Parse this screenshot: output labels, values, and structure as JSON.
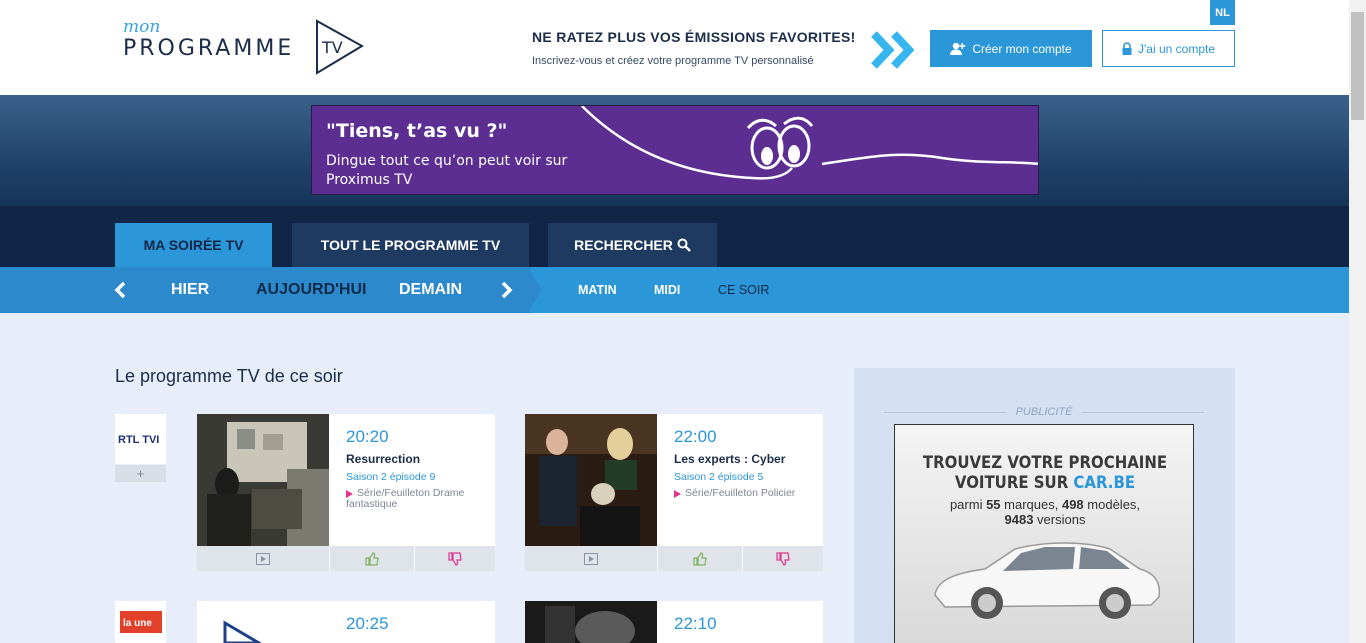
{
  "header": {
    "logo_mon": "mon",
    "logo_programme": "PROGRAMME",
    "logo_tv": "TV",
    "promo_title": "NE RATEZ PLUS VOS ÉMISSIONS FAVORITES!",
    "promo_subtitle": "Inscrivez-vous et créez votre programme TV personnalisé",
    "create_account": "Créer mon compte",
    "login": "J'ai un compte",
    "lang": "NL"
  },
  "banner": {
    "title": "\"Tiens, t’as vu ?\"",
    "text": "Dingue tout ce qu’on peut voir sur Proximus TV"
  },
  "tabs": [
    {
      "label": "MA SOIRÉE TV",
      "active": true
    },
    {
      "label": "TOUT LE PROGRAMME TV",
      "active": false
    },
    {
      "label": "RECHERCHER",
      "active": false
    }
  ],
  "days": [
    {
      "label": "HIER",
      "active": false
    },
    {
      "label": "AUJOURD'HUI",
      "active": true
    },
    {
      "label": "DEMAIN",
      "active": false
    }
  ],
  "slots": [
    {
      "label": "MATIN",
      "active": false
    },
    {
      "label": "MIDI",
      "active": false
    },
    {
      "label": "CE SOIR",
      "active": true
    }
  ],
  "section_title": "Le programme TV de ce soir",
  "channels": [
    {
      "logo": "RTL TVI",
      "plus": "+",
      "shows": [
        {
          "time": "20:20",
          "title": "Resurrection",
          "episode": "Saison 2 épisode 9",
          "genre": "Série/Feuilleton Drame fantastique"
        },
        {
          "time": "22:00",
          "title": "Les experts : Cyber",
          "episode": "Saison 2 épisode 5",
          "genre": "Série/Feuilleton Policier"
        }
      ]
    },
    {
      "logo": "la une",
      "shows": [
        {
          "time": "20:25",
          "title": "",
          "episode": "",
          "genre": ""
        },
        {
          "time": "22:10",
          "title": "",
          "episode": "",
          "genre": ""
        }
      ]
    }
  ],
  "sidebar": {
    "pub_label": "PUBLICITÉ",
    "ad_heading_1": "TROUVEZ VOTRE PROCHAINE",
    "ad_heading_2": "VOITURE SUR ",
    "ad_brand": "CAR.BE",
    "ad_line_1_pre": "parmi ",
    "ad_brands_count": "55",
    "ad_line_1_mid": " marques, ",
    "ad_models_count": "498",
    "ad_line_1_post": " modèles,",
    "ad_versions_count": "9483",
    "ad_line_2_post": " versions"
  },
  "colors": {
    "accent": "#2b97d9",
    "navy": "#112546",
    "banner": "#5c2e91",
    "pink": "#e2348d"
  }
}
